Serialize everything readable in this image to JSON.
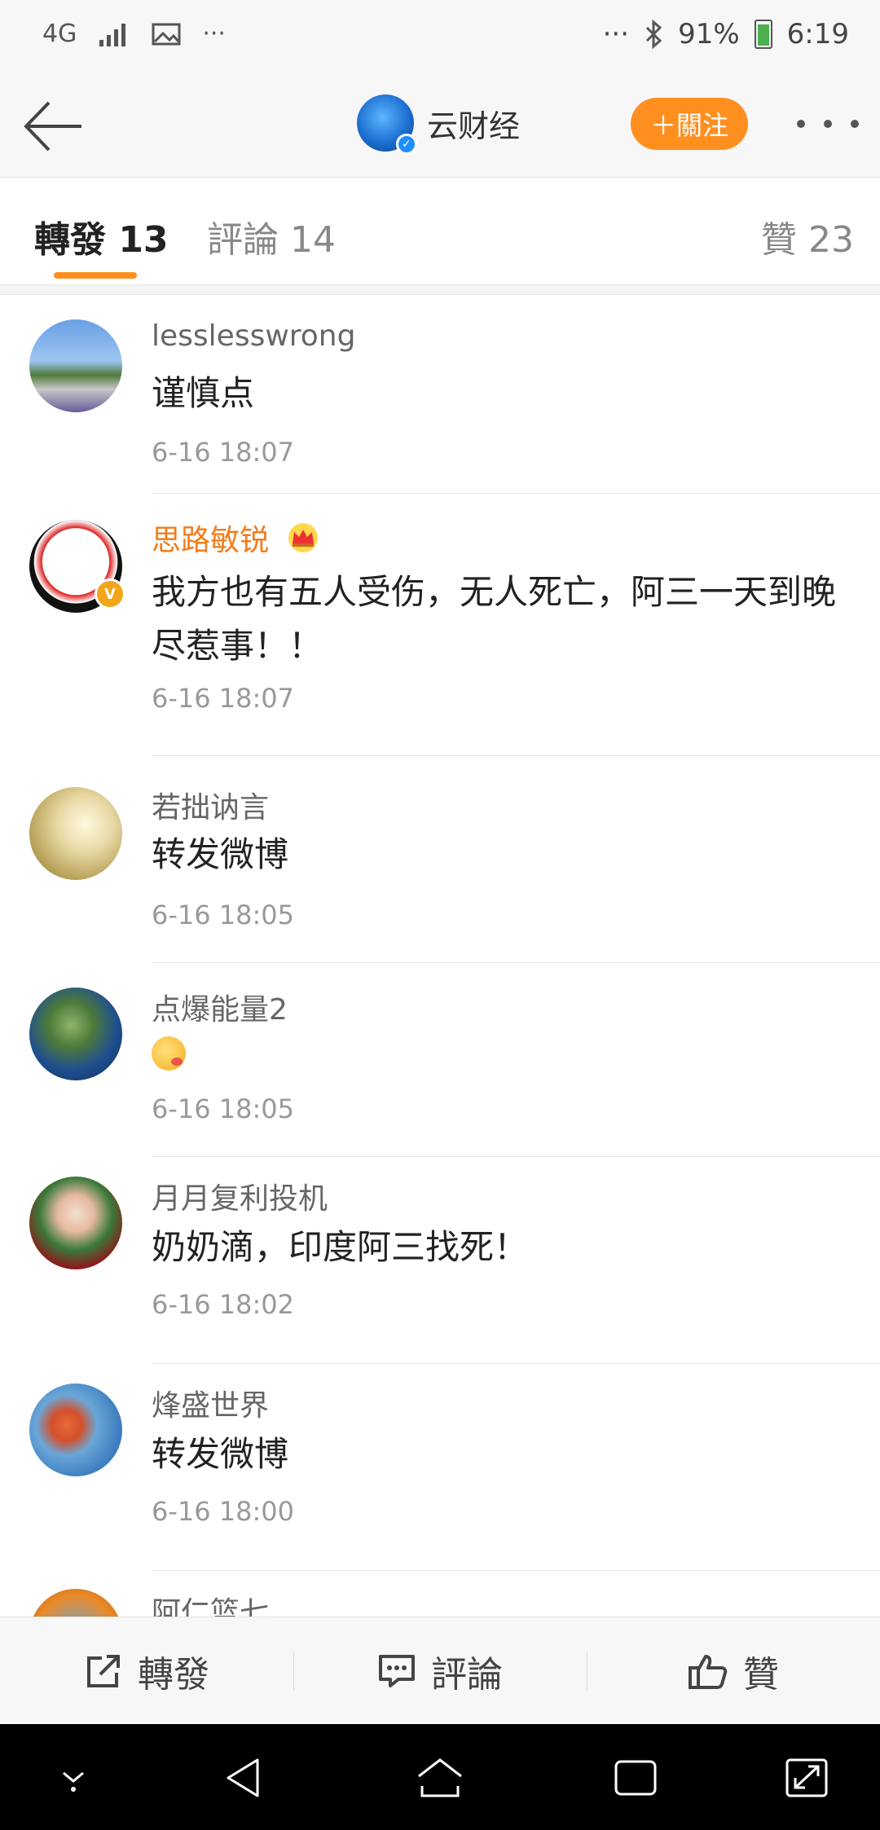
{
  "status_bar": {
    "network": "4G",
    "dots_left": "···",
    "dots_right": "···",
    "battery": "91%",
    "time": "6:19"
  },
  "header": {
    "account_name": "云财经",
    "follow_label": "＋關注"
  },
  "tabs": {
    "repost": "轉發 13",
    "comment": "評論 14",
    "like": "贊 23"
  },
  "comments": [
    {
      "user": "lesslesswrong",
      "text": "谨慎点",
      "time": "6-16 18:07"
    },
    {
      "user": "思路敏锐",
      "text": "我方也有五人受伤，无人死亡，阿三一天到晚尽惹事！！",
      "time": "6-16 18:07"
    },
    {
      "user": "若拙讷言",
      "text": "转发微博",
      "time": "6-16 18:05"
    },
    {
      "user": "点爆能量2",
      "text": "",
      "time": "6-16 18:05"
    },
    {
      "user": "月月复利投机",
      "text": "奶奶滴，印度阿三找死！",
      "time": "6-16 18:02"
    },
    {
      "user": "烽盛世界",
      "text": "转发微博",
      "time": "6-16 18:00"
    },
    {
      "user": "阿仁篮七"
    }
  ],
  "actions": {
    "repost": "轉發",
    "comment": "評論",
    "like": "贊"
  },
  "colors": {
    "accent": "#ff8f1f",
    "vip_name": "#f07c1a"
  }
}
